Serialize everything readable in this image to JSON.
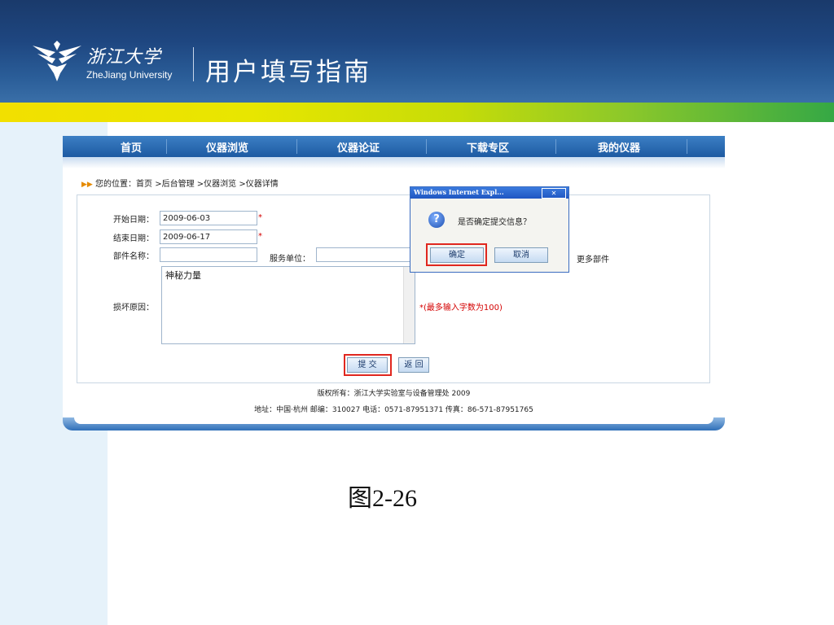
{
  "header": {
    "university_cn": "浙江大学",
    "university_en": "ZheJiang University",
    "title": "用户填写指南"
  },
  "nav": {
    "items": [
      {
        "label": "首页"
      },
      {
        "label": "仪器浏览"
      },
      {
        "label": "仪器论证"
      },
      {
        "label": "下载专区"
      },
      {
        "label": "我的仪器"
      }
    ]
  },
  "breadcrumb": {
    "text": "您的位置：首页 >后台管理 >仪器浏览 >仪器详情"
  },
  "form": {
    "start_label": "开始日期：",
    "start_value": "2009-06-03",
    "end_label": "结束日期：",
    "end_value": "2009-06-17",
    "required_mark": "*",
    "part_label": "部件名称：",
    "service_label": "服务单位：",
    "more_parts_link": "更多部件",
    "reason_label": "损坏原因：",
    "reason_value": "神秘力量",
    "reason_hint": "*(最多输入字数为100)",
    "submit_label": "提 交",
    "back_label": "返 回"
  },
  "dialog": {
    "title": "Windows Internet Expl...",
    "close": "✕",
    "icon": "?",
    "message": "是否确定提交信息？",
    "ok_label": "确定",
    "cancel_label": "取消"
  },
  "footer": {
    "copyright": "版权所有：浙江大学实验室与设备管理处 2009",
    "address": "地址：中国·杭州 邮编：310027 电话：0571-87951371 传真：86-571-87951765"
  },
  "caption": "图2-26",
  "colors": {
    "header_blue": "#1e4680",
    "band_yellow": "#f2e000",
    "band_green": "#35a845",
    "highlight_red": "#e0271f"
  }
}
